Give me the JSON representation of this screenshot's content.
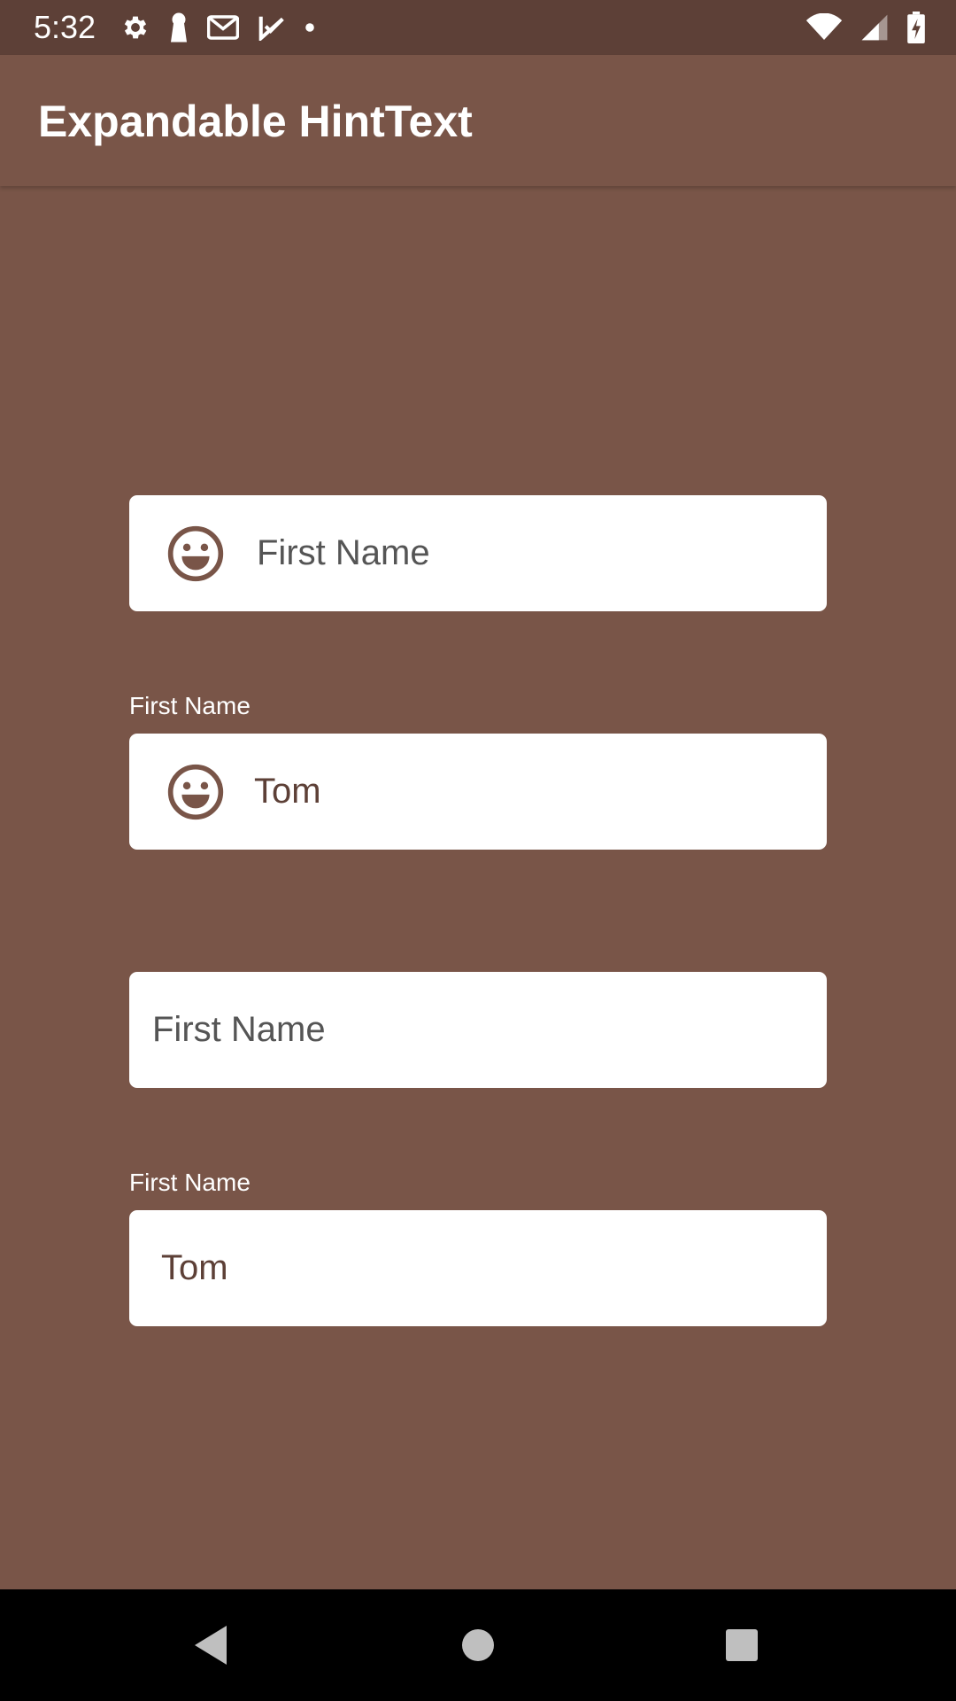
{
  "status_bar": {
    "time": "5:32",
    "left_icons": [
      "gear-icon",
      "keyhole-icon",
      "gmail-icon",
      "task-check-icon",
      "dot-icon"
    ],
    "right_icons": [
      "wifi-icon",
      "signal-icon",
      "battery-charging-icon"
    ]
  },
  "app_bar": {
    "title": "Expandable HintText"
  },
  "fields": [
    {
      "icon": "smiley-icon",
      "label": "",
      "hint": "First Name",
      "value": ""
    },
    {
      "icon": "smiley-icon",
      "label": "First Name",
      "hint": "",
      "value": "Tom"
    },
    {
      "icon": "",
      "label": "",
      "hint": "First Name",
      "value": ""
    },
    {
      "icon": "",
      "label": "First Name",
      "hint": "",
      "value": "Tom"
    }
  ],
  "nav_bar": {
    "buttons": [
      "back-icon",
      "home-icon",
      "recents-icon"
    ]
  },
  "colors": {
    "primary": "#795548",
    "primary_dark": "#5d4037",
    "field_background": "#ffffff",
    "hint_text": "#555555",
    "icon_tint": "#795548"
  }
}
